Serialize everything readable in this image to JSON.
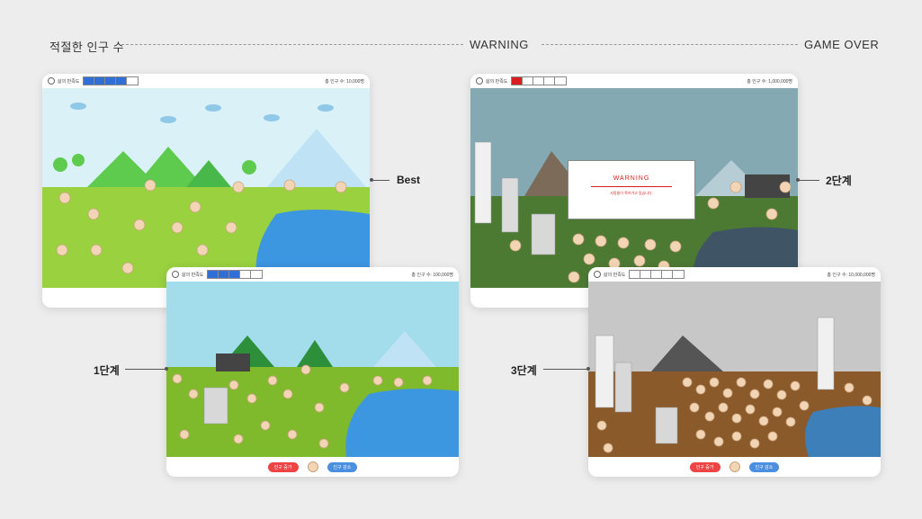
{
  "headers": {
    "left": "적절한 인구 수",
    "middle": "WARNING",
    "right": "GAME OVER"
  },
  "labels": {
    "best": "Best",
    "stage1": "1단계",
    "stage2": "2단계",
    "stage3": "3단계"
  },
  "screen": {
    "bar_title": "삶의 만족도",
    "pop_best": "총 인구 수: 10,000명",
    "pop_stage1": "총 인구 수: 100,000명",
    "pop_stage2": "총 인구 수: 1,000,000명",
    "pop_stage3": "총 인구 수: 10,000,000명",
    "btn_increase": "인구 증가",
    "btn_decrease": "인구 감소",
    "warning_title": "WARNING",
    "warning_text": "사람들이 죽어가고 있습니다."
  },
  "satisfaction": {
    "best": 0.8,
    "stage1": 0.6,
    "stage2": 0.2,
    "stage3": 0.0
  },
  "colors": {
    "accent_blue": "#2f6fd6",
    "warning_red": "#d71f1f",
    "plus_red": "#e44",
    "minus_blue": "#4a8fe0"
  }
}
